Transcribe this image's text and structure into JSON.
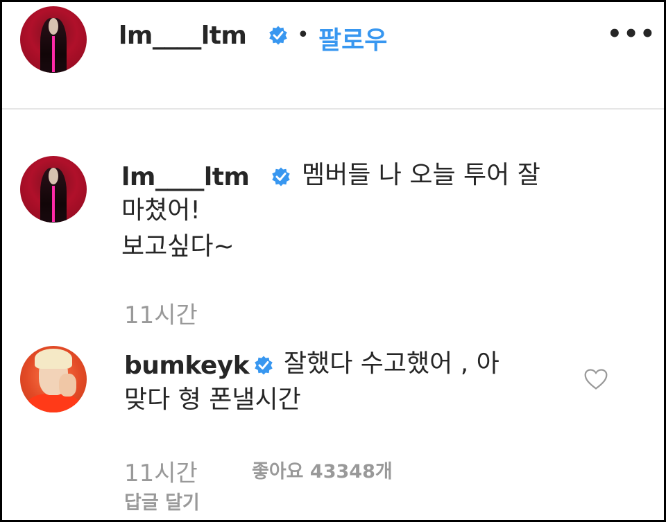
{
  "post_header": {
    "username": "lm____ltm",
    "separator": "•",
    "follow_label": "팔로우",
    "more_label": "•••",
    "avatar_icon": "profile-avatar-icon",
    "verified_icon": "verified-badge-icon"
  },
  "comments": [
    {
      "username": "lm____ltm",
      "text_line1": "멤버들 나 오늘 투어 잘",
      "text_line2": "마쳤어!",
      "text_line3": "보고싶다~",
      "time": "11시간"
    },
    {
      "username": "bumkeyk",
      "text_line1": "잘했다 수고했어 , 아",
      "text_line2": "맞다 형 폰낼시간",
      "time": "11시간",
      "likes": "좋아요 43348개",
      "reply_label": "답글 달기",
      "like_icon": "heart-icon"
    }
  ],
  "colors": {
    "accent_blue": "#3897f0",
    "text": "#262626",
    "muted": "#999999",
    "border": "#000000",
    "divider": "#e6e6e6"
  }
}
